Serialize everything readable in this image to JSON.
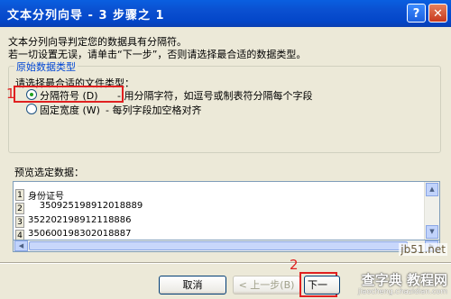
{
  "window": {
    "title": "文本分列向导 - 3 步骤之 1",
    "help_label": "?",
    "close_label": "✕"
  },
  "intro": {
    "line1": "文本分列向导判定您的数据具有分隔符。",
    "line2": "若一切设置无误，请单击“下一步”，否则请选择最合适的数据类型。"
  },
  "group": {
    "legend": "原始数据类型",
    "prompt": "请选择最合适的文件类型：",
    "options": [
      {
        "label": "分隔符号 (D)",
        "description": "- 用分隔字符，如逗号或制表符分隔每个字段",
        "selected": true
      },
      {
        "label": "固定宽度 (W)",
        "description": "- 每列字段加空格对齐",
        "selected": false
      }
    ]
  },
  "preview": {
    "label": "预览选定数据：",
    "rows": [
      {
        "num": "1",
        "text": "身份证号"
      },
      {
        "num": "2",
        "text": "    350925198912018889"
      },
      {
        "num": "3",
        "text": "352202198912118886"
      },
      {
        "num": "4",
        "text": "350600198302018887"
      }
    ]
  },
  "buttons": {
    "cancel": "取消",
    "back": "< 上一步(B)",
    "next": "下一"
  },
  "annotations": {
    "step1": "1",
    "step2": "2"
  },
  "watermark": {
    "site": "jb51.net",
    "brand": "查字典 教程网",
    "url": "jiaocheng.chazidian.com"
  },
  "colors": {
    "titlebar": "#0A4FD0",
    "annotation_red": "#E02020",
    "legend_blue": "#0046D5"
  }
}
